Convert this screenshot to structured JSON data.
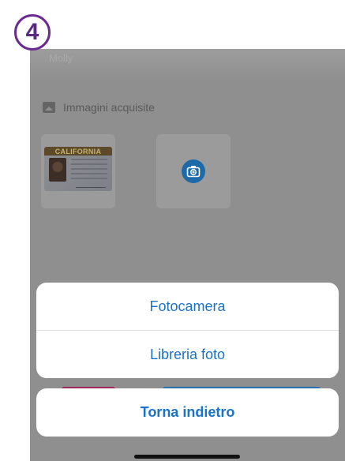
{
  "step": {
    "number": "4",
    "accent": "#6b2c91"
  },
  "screen": {
    "faint_title": "Molly"
  },
  "section": {
    "label": "Immagini acquisite",
    "icon": "gallery-icon"
  },
  "thumbnails": {
    "license_state": "CALIFORNIA",
    "add_icon": "camera-plus-icon"
  },
  "action_sheet": {
    "options": [
      {
        "label": "Fotocamera"
      },
      {
        "label": "Libreria foto"
      }
    ],
    "cancel_label": "Torna indietro",
    "accent": "#1a73c9"
  }
}
